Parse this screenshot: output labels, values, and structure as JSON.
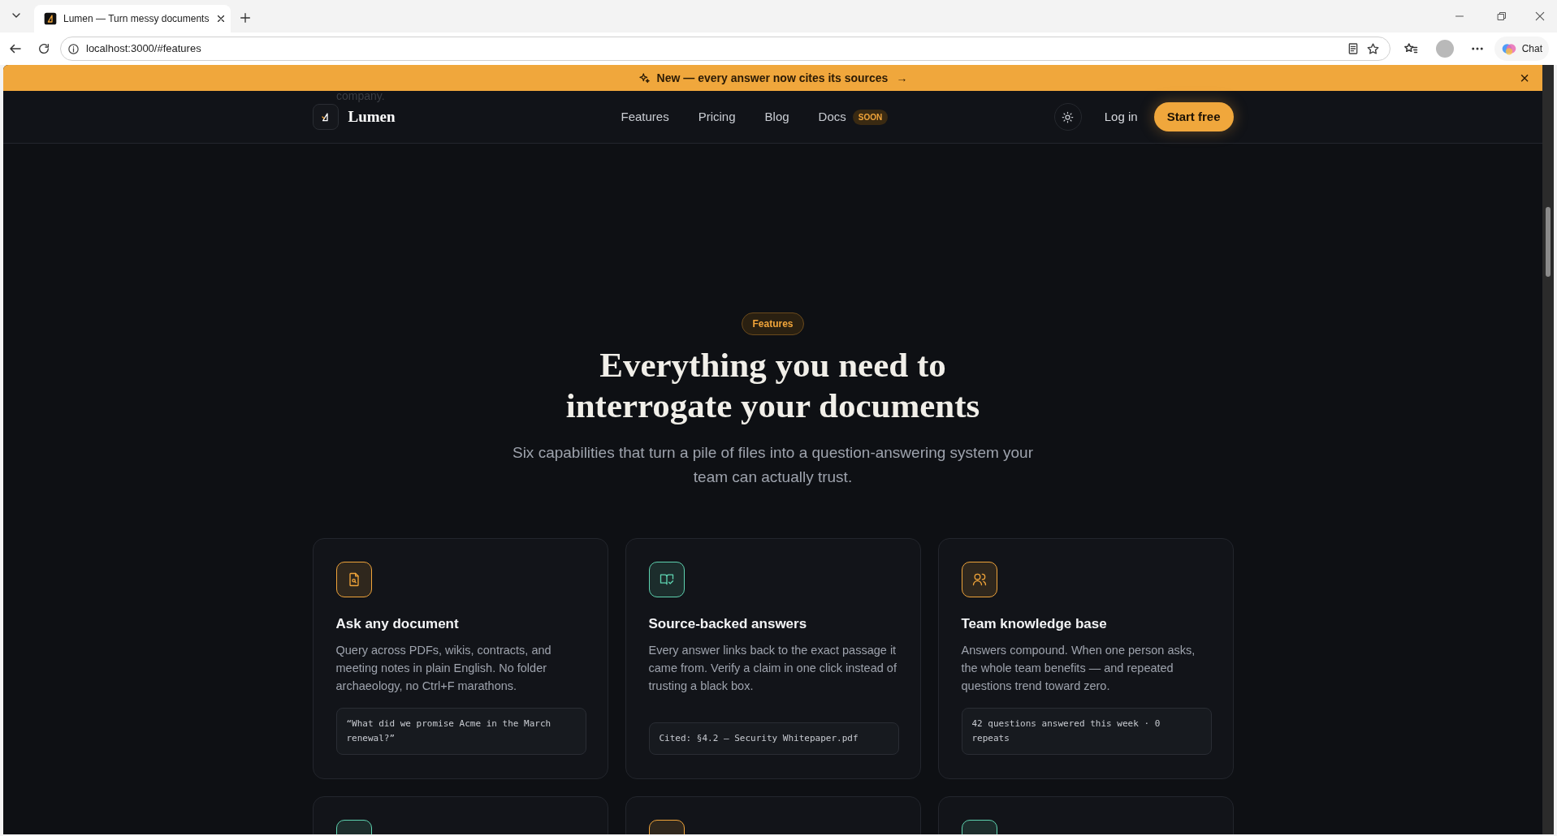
{
  "browser": {
    "tab_title": "Lumen — Turn messy documents",
    "url": "localhost:3000/#features",
    "chat_label": "Chat"
  },
  "banner": {
    "text": "New — every answer now cites its sources",
    "arrow": "→",
    "close": "×"
  },
  "ghost_text": "company.",
  "nav": {
    "logo": "Lumen",
    "links": [
      {
        "label": "Features"
      },
      {
        "label": "Pricing"
      },
      {
        "label": "Blog"
      },
      {
        "label": "Docs",
        "badge": "SOON"
      }
    ],
    "login": "Log in",
    "cta": "Start free"
  },
  "section": {
    "badge": "Features",
    "title_lines": [
      "Everything you need to",
      "interrogate your documents"
    ],
    "subtitle": "Six capabilities that turn a pile of files into a question-answering system your team can actually trust."
  },
  "cards": [
    {
      "color": "#f0a43a",
      "title": "Ask any document",
      "body": "Query across PDFs, wikis, contracts, and meeting notes in plain English. No folder archaeology, no Ctrl+F marathons.",
      "snippet": "“What did we promise Acme in the March renewal?”"
    },
    {
      "color": "#5ed3b0",
      "title": "Source-backed answers",
      "body": "Every answer links back to the exact passage it came from. Verify a claim in one click instead of trusting a black box.",
      "snippet": "Cited: §4.2 — Security Whitepaper.pdf"
    },
    {
      "color": "#f0a43a",
      "title": "Team knowledge base",
      "body": "Answers compound. When one person asks, the whole team benefits — and repeated questions trend toward zero.",
      "snippet": "42 questions answered this week · 0 repeats"
    },
    {
      "color": "#5ed3b0"
    },
    {
      "color": "#f0a43a"
    },
    {
      "color": "#5ed3b0"
    }
  ]
}
